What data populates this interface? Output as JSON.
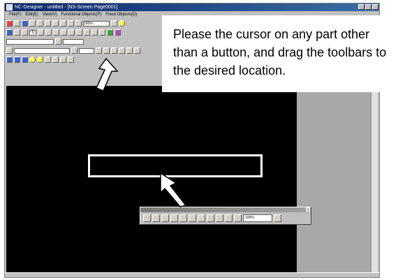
{
  "window": {
    "title": "NC-Designer - untitled - [NS-Screen Page0001]",
    "title_bar_color": "#0a246a"
  },
  "menu": {
    "items": [
      "File(F)",
      "Edit(E)",
      "View(V)",
      "Functional Objects(P)",
      "Fixed Objects(D)"
    ]
  },
  "toolbars": {
    "zoom_value": "100%",
    "page_number": "5"
  },
  "callout": {
    "text": "Please the cursor on any part other than a button, and drag the toolbars to the desired location."
  },
  "floating_toolbar": {
    "zoom_value": "100%"
  },
  "colors": {
    "canvas": "#000000",
    "highlight": "#ffffff"
  }
}
